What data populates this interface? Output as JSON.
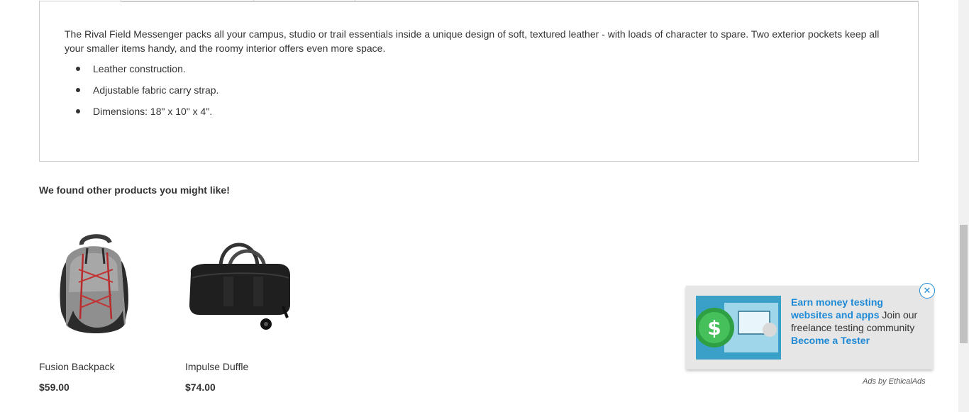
{
  "description": {
    "text": "The Rival Field Messenger packs all your campus, studio or trail essentials inside a unique design of soft, textured leather - with loads of character to spare. Two exterior pockets keep all your smaller items handy, and the roomy interior offers even more space.",
    "features": [
      "Leather construction.",
      "Adjustable fabric carry strap.",
      "Dimensions: 18\" x 10\" x 4\"."
    ]
  },
  "related": {
    "title": "We found other products you might like!",
    "products": [
      {
        "name": "Fusion Backpack",
        "price": "$59.00",
        "image": "backpack-image"
      },
      {
        "name": "Impulse Duffle",
        "price": "$74.00",
        "image": "duffle-image"
      }
    ]
  },
  "ad": {
    "headline": "Earn money testing websites and apps",
    "body": "Join our freelance testing community",
    "cta": "Become a Tester",
    "close_icon": "close-icon",
    "attribution": "Ads by EthicalAds",
    "accent_color": "#1e8ad6"
  }
}
